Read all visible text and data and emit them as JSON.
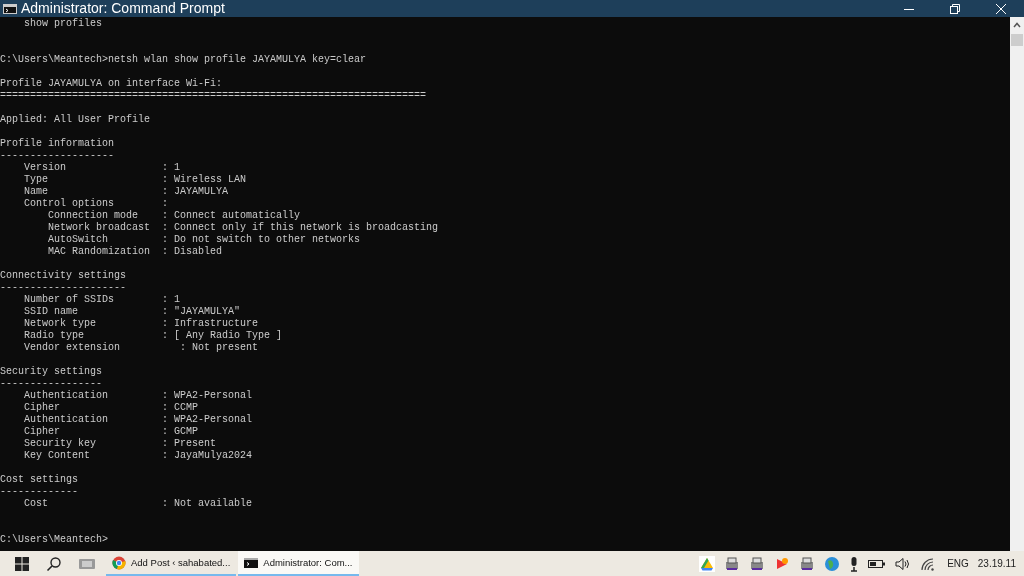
{
  "window": {
    "title": "Administrator: Command Prompt"
  },
  "console": {
    "groups": [
      [
        "    show profiles"
      ],
      [
        "C:\\Users\\Meantech>netsh wlan show profile JAYAMULYA key=clear"
      ],
      [
        "Profile JAYAMULYA on interface Wi-Fi:",
        "======================================================================="
      ],
      [
        "Applied: All User Profile"
      ],
      [
        "Profile information",
        "-------------------",
        "    Version                : 1",
        "    Type                   : Wireless LAN",
        "    Name                   : JAYAMULYA",
        "    Control options        :",
        "        Connection mode    : Connect automatically",
        "        Network broadcast  : Connect only if this network is broadcasting",
        "        AutoSwitch         : Do not switch to other networks",
        "        MAC Randomization  : Disabled"
      ],
      [
        "Connectivity settings",
        "---------------------",
        "    Number of SSIDs        : 1",
        "    SSID name              : \"JAYAMULYA\"",
        "    Network type           : Infrastructure",
        "    Radio type             : [ Any Radio Type ]",
        "    Vendor extension          : Not present"
      ],
      [
        "Security settings",
        "-----------------",
        "    Authentication         : WPA2-Personal",
        "    Cipher                 : CCMP",
        "    Authentication         : WPA2-Personal",
        "    Cipher                 : GCMP",
        "    Security key           : Present",
        "    Key Content            : JayaMulya2024"
      ],
      [
        "Cost settings",
        "-------------",
        "    Cost                   : Not available"
      ],
      [
        "C:\\Users\\Meantech>"
      ]
    ]
  },
  "taskbar": {
    "apps": [
      {
        "kind": "browser",
        "label": "Add Post ‹ sahabated...",
        "selected": false
      },
      {
        "kind": "console",
        "label": "Administrator: Com...",
        "selected": true
      }
    ],
    "language": "ENG",
    "clock": "23.19.11"
  }
}
